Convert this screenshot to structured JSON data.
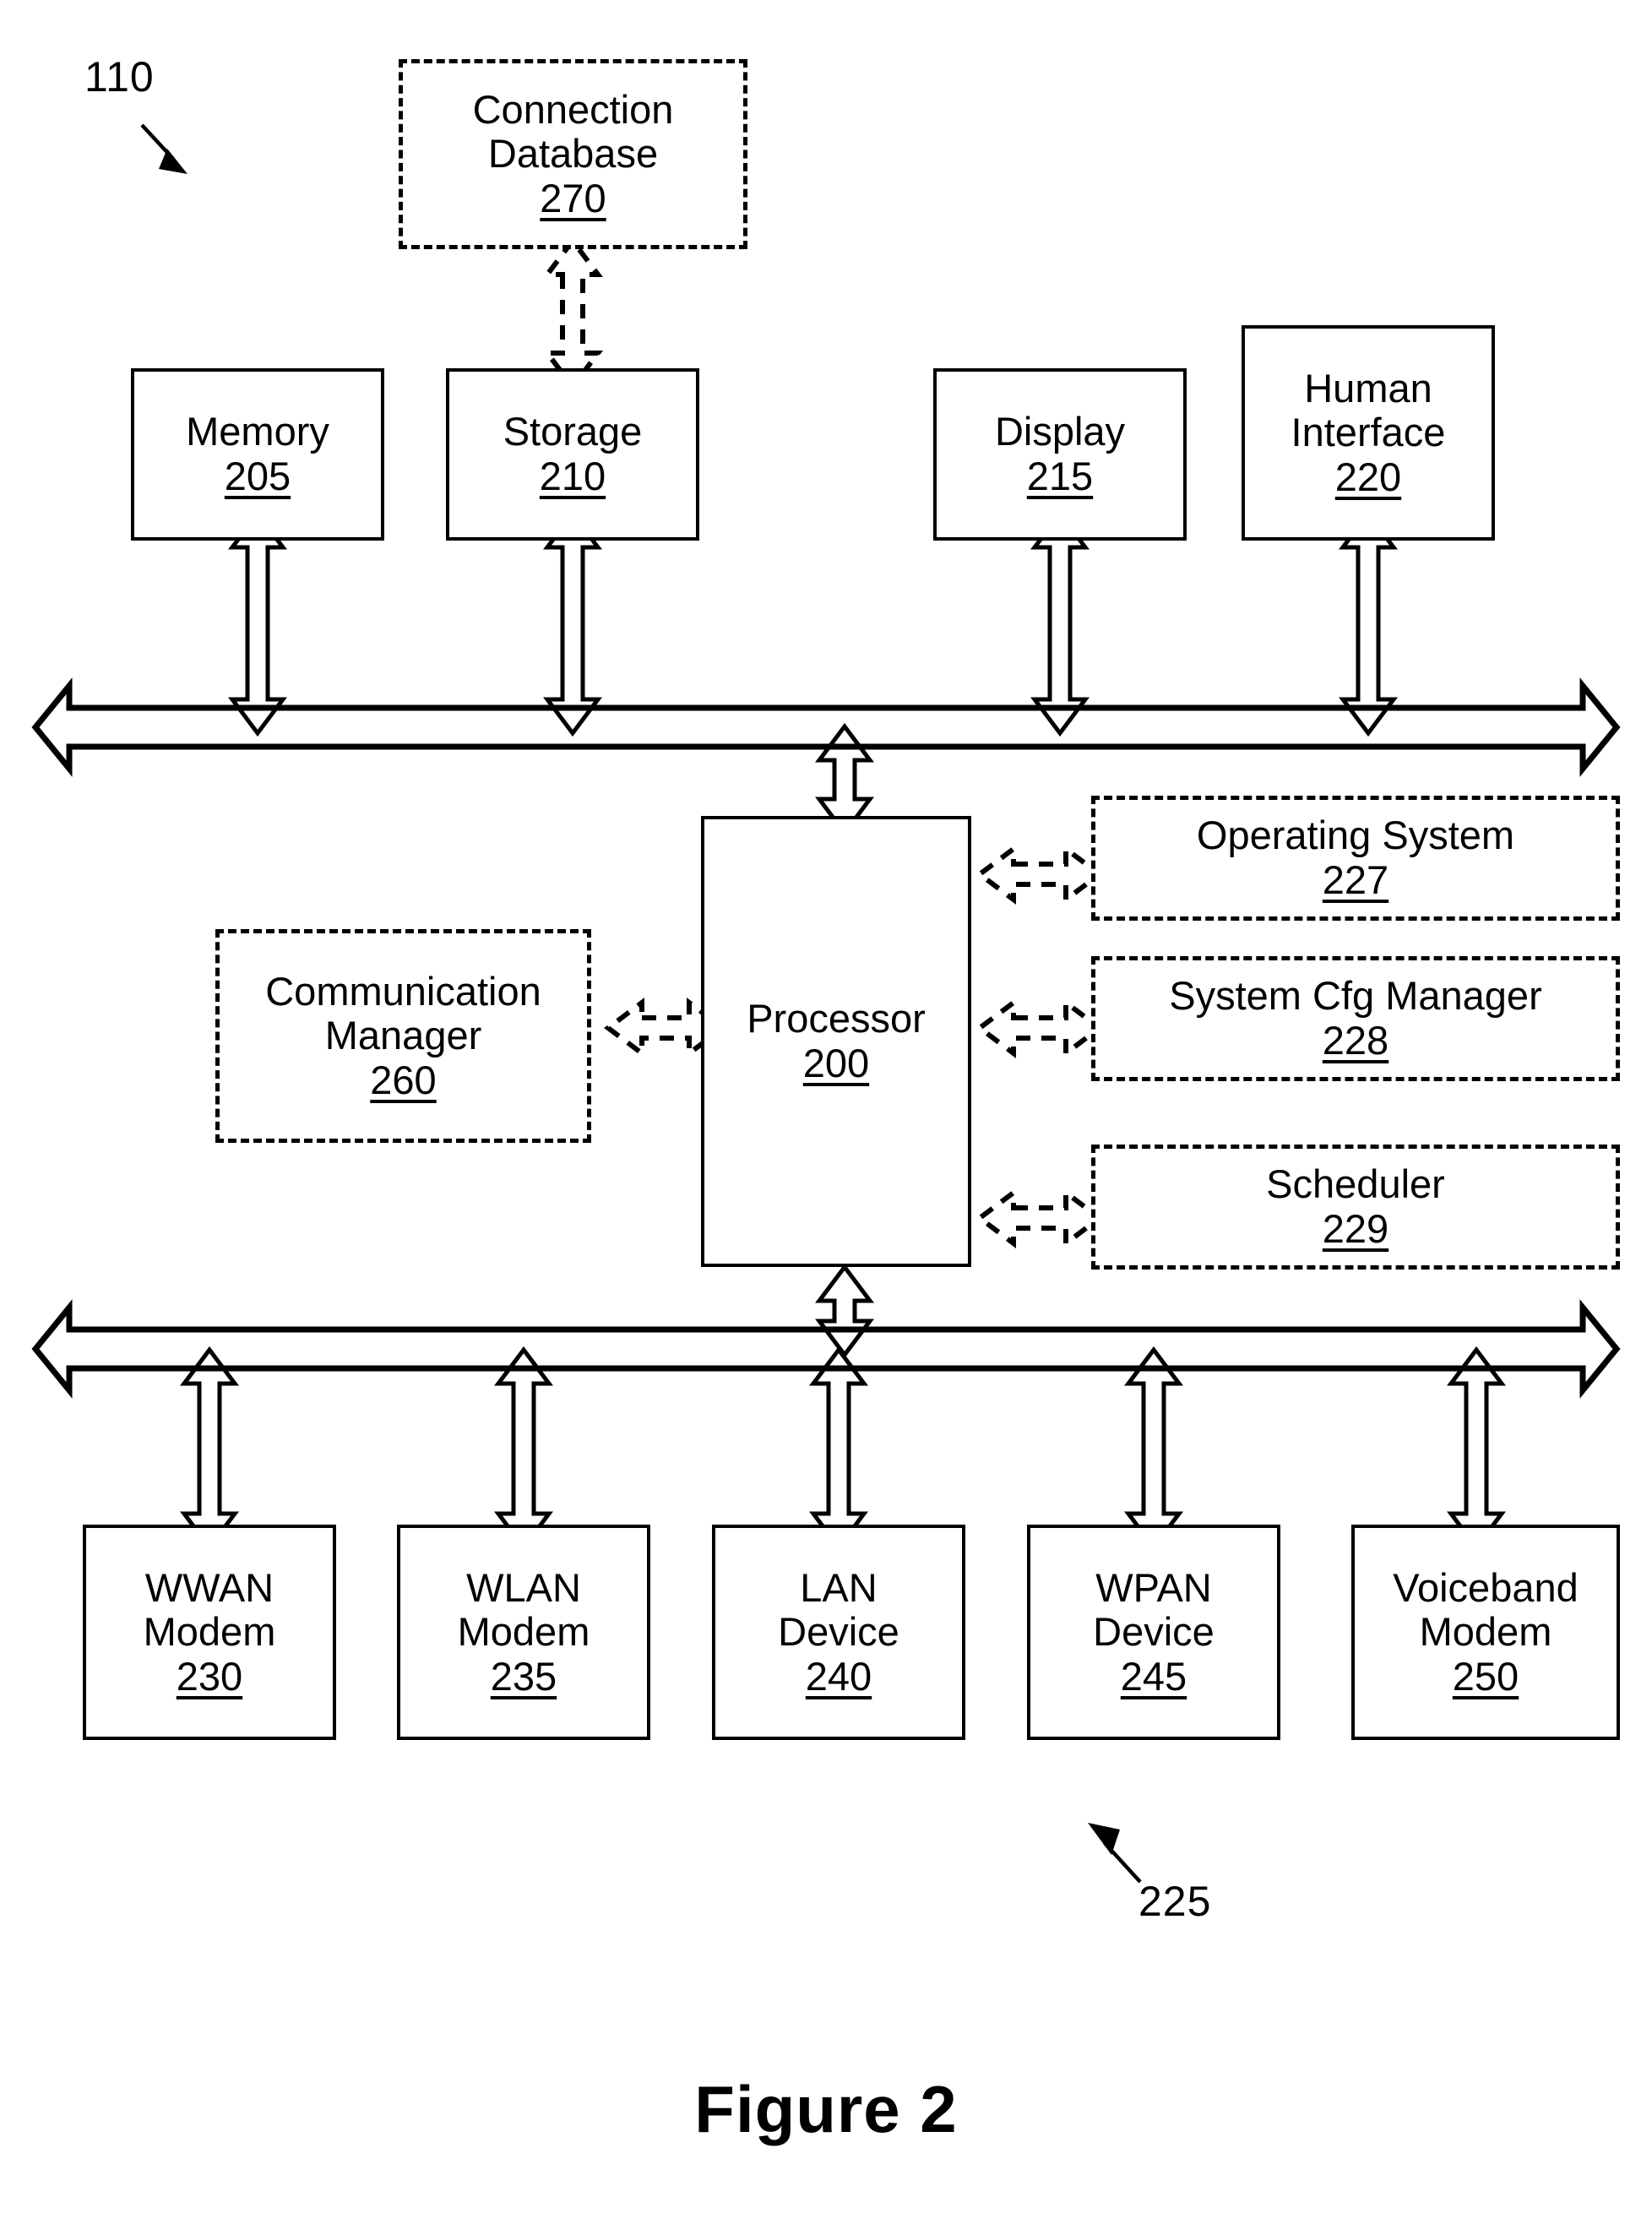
{
  "figure": {
    "caption": "Figure 2",
    "system_numeral": "110",
    "bus_numeral": "225"
  },
  "blocks": {
    "connection_database": {
      "label": "Connection\nDatabase",
      "ref": "270",
      "style": "dashed"
    },
    "memory": {
      "label": "Memory",
      "ref": "205",
      "style": "solid"
    },
    "storage": {
      "label": "Storage",
      "ref": "210",
      "style": "solid"
    },
    "display": {
      "label": "Display",
      "ref": "215",
      "style": "solid"
    },
    "human_interface": {
      "label": "Human\nInterface",
      "ref": "220",
      "style": "solid"
    },
    "processor": {
      "label": "Processor",
      "ref": "200",
      "style": "solid"
    },
    "communication_manager": {
      "label": "Communication\nManager",
      "ref": "260",
      "style": "dashed"
    },
    "operating_system": {
      "label": "Operating System",
      "ref": "227",
      "style": "dashed"
    },
    "system_cfg_manager": {
      "label": "System Cfg Manager",
      "ref": "228",
      "style": "dashed"
    },
    "scheduler": {
      "label": "Scheduler",
      "ref": "229",
      "style": "dashed"
    },
    "wwan_modem": {
      "label": "WWAN\nModem",
      "ref": "230",
      "style": "solid"
    },
    "wlan_modem": {
      "label": "WLAN\nModem",
      "ref": "235",
      "style": "solid"
    },
    "lan_device": {
      "label": "LAN\nDevice",
      "ref": "240",
      "style": "solid"
    },
    "wpan_device": {
      "label": "WPAN\nDevice",
      "ref": "245",
      "style": "solid"
    },
    "voiceband_modem": {
      "label": "Voiceband\nModem",
      "ref": "250",
      "style": "solid"
    }
  },
  "colors": {
    "line": "#000000",
    "background": "#ffffff"
  }
}
